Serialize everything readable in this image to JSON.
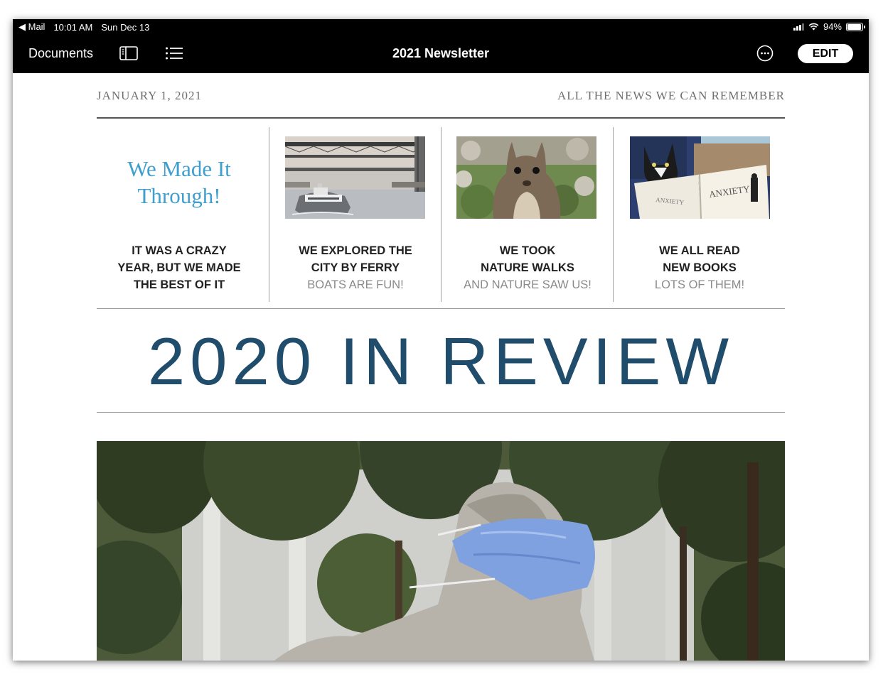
{
  "status_bar": {
    "back_app": "Mail",
    "time": "10:01 AM",
    "date": "Sun Dec 13",
    "battery": "94%",
    "battery_level": 0.94
  },
  "toolbar": {
    "documents_label": "Documents",
    "title": "2021 Newsletter",
    "edit_label": "EDIT",
    "icons": [
      "sidebar-icon",
      "list-icon",
      "more-icon"
    ]
  },
  "newsletter": {
    "date": "JANUARY 1, 2021",
    "tagline": "ALL THE NEWS WE CAN REMEMBER",
    "headline": {
      "line1": "We Made It",
      "line2": "Through!"
    },
    "columns": [
      {
        "line1": "IT WAS A CRAZY",
        "line2": "YEAR, BUT WE MADE",
        "line3": "THE BEST OF IT"
      },
      {
        "line1": "WE EXPLORED THE",
        "line2": "CITY BY FERRY",
        "sub": "BOATS ARE FUN!"
      },
      {
        "line1": "WE TOOK",
        "line2": "NATURE WALKS",
        "sub": "AND NATURE SAW US!"
      },
      {
        "line1": "WE ALL READ",
        "line2": "NEW BOOKS",
        "sub": "LOTS OF THEM!"
      }
    ],
    "review_title": "2020 IN REVIEW",
    "book_cover_text": "ANXIETY",
    "colors": {
      "headline": "#3f9fcf",
      "review_title": "#1f4d6b",
      "toolbar": "#000000"
    }
  }
}
